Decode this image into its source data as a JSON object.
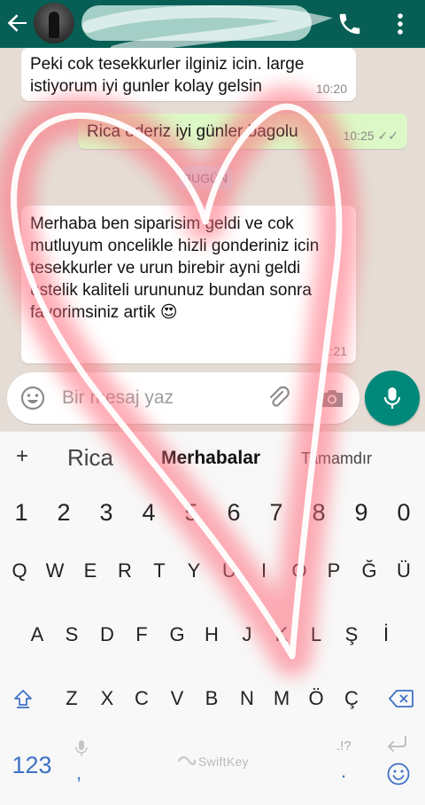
{
  "header": {
    "back_icon": "arrow-left-icon",
    "avatar": "contact-photo",
    "call_icon": "phone-icon",
    "more_icon": "more-vert-icon",
    "colors": {
      "bar": "#075e54",
      "icon": "#ffffff"
    }
  },
  "chat": {
    "messages": [
      {
        "direction": "in",
        "text": "Peki cok tesekkurler ilginiz icin. large istiyorum iyi gunler kolay gelsin",
        "time": "10:20"
      },
      {
        "direction": "out",
        "text": "Rica ederiz iyi günler bagolu",
        "time": "10:25",
        "status": "✓✓"
      },
      {
        "direction": "in",
        "text": "Merhaba ben siparisim geldi ve cok mutluyum oncelikle hizli gonderiniz icin tesekkurler ve urun birebir ayni geldi ustelik kaliteli urununuz bundan sonra favorimsiniz artik 😍",
        "time": "1:21"
      }
    ],
    "date_chip": "BUGÜN",
    "colors": {
      "background": "#e5ddd5",
      "incoming": "#ffffff",
      "outgoing": "#dcf8c6"
    }
  },
  "composer": {
    "placeholder": "Bir mesaj yaz",
    "emoji_icon": "emoji-icon",
    "attach_icon": "paperclip-icon",
    "camera_icon": "camera-icon",
    "mic_icon": "mic-icon",
    "mic_color": "#00897b"
  },
  "keyboard": {
    "predictions": {
      "plus": "+",
      "left": "Rica",
      "middle": "Merhabalar",
      "right": "Tamamdır"
    },
    "numbers": [
      "1",
      "2",
      "3",
      "4",
      "5",
      "6",
      "7",
      "8",
      "9",
      "0"
    ],
    "row1": [
      "Q",
      "W",
      "E",
      "R",
      "T",
      "Y",
      "U",
      "I",
      "O",
      "P",
      "Ğ",
      "Ü"
    ],
    "row2": [
      "A",
      "S",
      "D",
      "F",
      "G",
      "H",
      "J",
      "K",
      "L",
      "Ş",
      "İ"
    ],
    "row3": [
      "Z",
      "X",
      "C",
      "V",
      "B",
      "N",
      "M",
      "Ö",
      "Ç"
    ],
    "shift_icon": "shift-icon",
    "backspace_icon": "backspace-icon",
    "num_key": "123",
    "comma": ",",
    "period": ".",
    "period_hint": ".!?",
    "space_brand": "SwiftKey",
    "enter_icon": "enter-icon",
    "emoji_icon": "smiley-icon",
    "accent": "#3f72c6"
  },
  "overlay": {
    "shape": "heart",
    "color": "#ff6b7a"
  }
}
